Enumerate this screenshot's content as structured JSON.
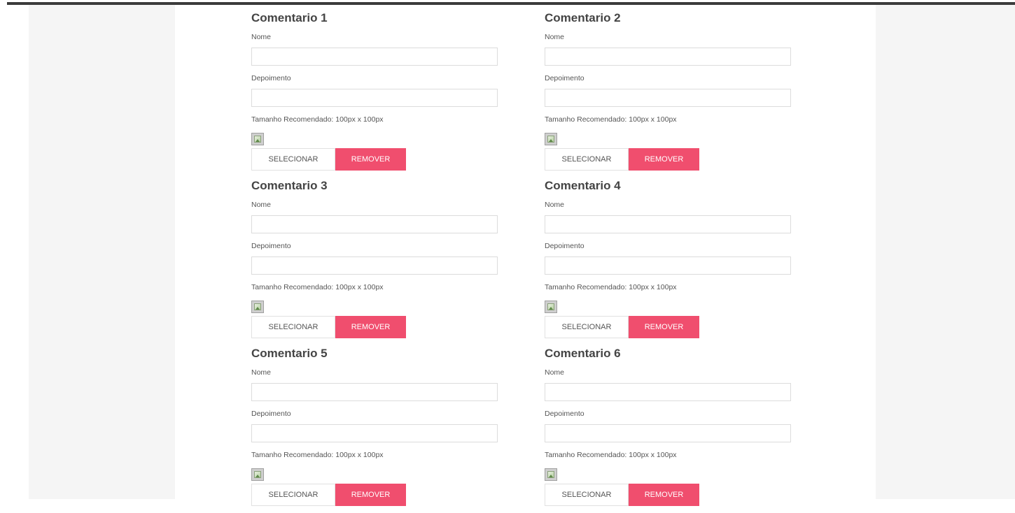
{
  "comments": [
    {
      "title": "Comentario 1",
      "name_label": "Nome",
      "name_value": "",
      "testimonial_label": "Depoimento",
      "testimonial_value": "",
      "size_hint": "Tamanho Recomendado: 100px x 100px",
      "select_label": "SELECIONAR",
      "remove_label": "REMOVER"
    },
    {
      "title": "Comentario 2",
      "name_label": "Nome",
      "name_value": "",
      "testimonial_label": "Depoimento",
      "testimonial_value": "",
      "size_hint": "Tamanho Recomendado: 100px x 100px",
      "select_label": "SELECIONAR",
      "remove_label": "REMOVER"
    },
    {
      "title": "Comentario 3",
      "name_label": "Nome",
      "name_value": "",
      "testimonial_label": "Depoimento",
      "testimonial_value": "",
      "size_hint": "Tamanho Recomendado: 100px x 100px",
      "select_label": "SELECIONAR",
      "remove_label": "REMOVER"
    },
    {
      "title": "Comentario 4",
      "name_label": "Nome",
      "name_value": "",
      "testimonial_label": "Depoimento",
      "testimonial_value": "",
      "size_hint": "Tamanho Recomendado: 100px x 100px",
      "select_label": "SELECIONAR",
      "remove_label": "REMOVER"
    },
    {
      "title": "Comentario 5",
      "name_label": "Nome",
      "name_value": "",
      "testimonial_label": "Depoimento",
      "testimonial_value": "",
      "size_hint": "Tamanho Recomendado: 100px x 100px",
      "select_label": "SELECIONAR",
      "remove_label": "REMOVER"
    },
    {
      "title": "Comentario 6",
      "name_label": "Nome",
      "name_value": "",
      "testimonial_label": "Depoimento",
      "testimonial_value": "",
      "size_hint": "Tamanho Recomendado: 100px x 100px",
      "select_label": "SELECIONAR",
      "remove_label": "REMOVER"
    }
  ],
  "colors": {
    "remove_button": "#f04e6e",
    "page_background": "#f5f5f5",
    "content_background": "#ffffff"
  },
  "icons": {
    "image_placeholder": "broken-image-icon"
  }
}
